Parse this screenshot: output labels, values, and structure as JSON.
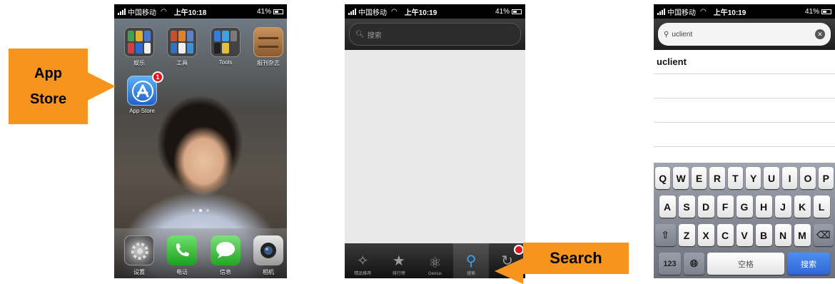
{
  "status_bar_1": {
    "carrier": "中国移动",
    "time": "上午10:18",
    "battery": "41%"
  },
  "status_bar_2": {
    "carrier": "中国移动",
    "time": "上午10:19",
    "battery": "41%"
  },
  "status_bar_3": {
    "carrier": "中国移动",
    "time": "上午10:19",
    "battery": "41%"
  },
  "home": {
    "folders": [
      {
        "label": "娱乐"
      },
      {
        "label": "工具"
      },
      {
        "label": "Tools"
      },
      {
        "label": "报刊杂志"
      }
    ],
    "app_store": {
      "label": "App Store",
      "badge": "1"
    },
    "dock": [
      {
        "label": "设置",
        "icon": "gear-icon"
      },
      {
        "label": "电话",
        "icon": "phone-icon"
      },
      {
        "label": "信息",
        "icon": "message-icon"
      },
      {
        "label": "相机",
        "icon": "camera-icon"
      }
    ]
  },
  "callouts": {
    "app_store": "App Store",
    "search": "Search"
  },
  "store": {
    "search_placeholder": "搜索",
    "tabs": [
      {
        "label": "精品推荐",
        "icon": "featured-icon"
      },
      {
        "label": "排行榜",
        "icon": "star-icon"
      },
      {
        "label": "Genius",
        "icon": "genius-icon"
      },
      {
        "label": "搜索",
        "icon": "search-icon"
      },
      {
        "label": "更新",
        "icon": "update-icon"
      }
    ]
  },
  "results_screen": {
    "query": "uclient",
    "results": [
      "uclient"
    ]
  },
  "keyboard": {
    "row1": [
      "Q",
      "W",
      "E",
      "R",
      "T",
      "Y",
      "U",
      "I",
      "O",
      "P"
    ],
    "row2": [
      "A",
      "S",
      "D",
      "F",
      "G",
      "H",
      "J",
      "K",
      "L"
    ],
    "row3": [
      "Z",
      "X",
      "C",
      "V",
      "B",
      "N",
      "M"
    ],
    "numbers_key": "123",
    "space_key": "空格",
    "search_key": "搜索"
  },
  "colors": {
    "callout": "#f7941d",
    "badge": "#e0141e",
    "accent": "#38a4f0"
  }
}
